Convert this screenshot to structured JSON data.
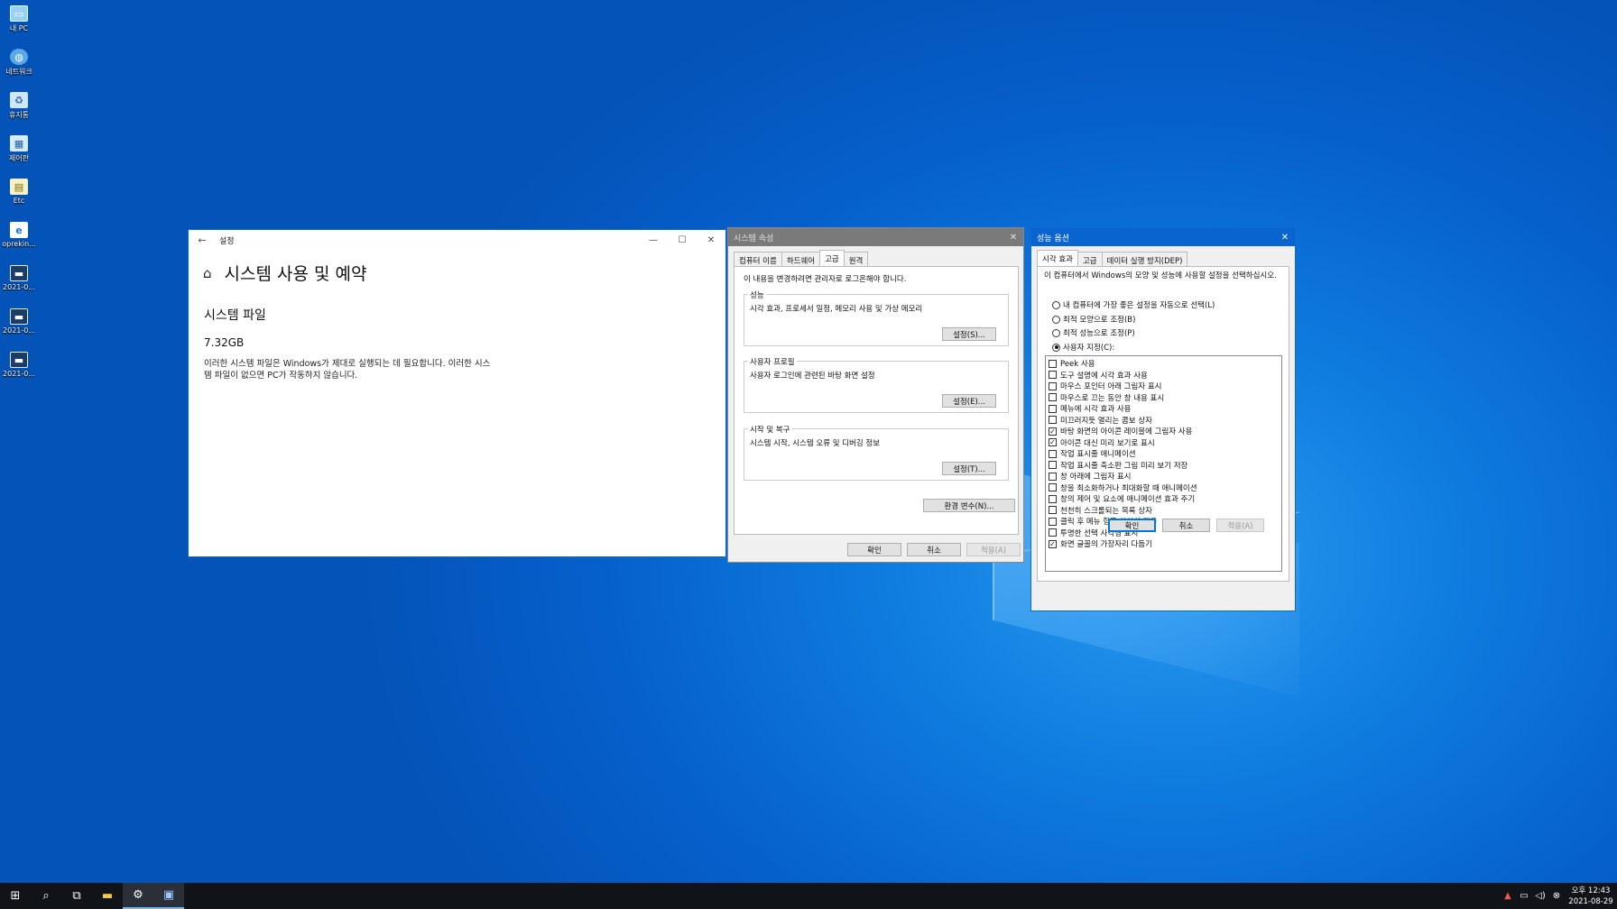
{
  "desktop": {
    "icons": [
      {
        "label": "내 PC",
        "icon": "computer-icon"
      },
      {
        "label": "네트워크",
        "icon": "network-icon"
      },
      {
        "label": "휴지통",
        "icon": "recycle-bin-icon"
      },
      {
        "label": "제어판",
        "icon": "control-panel-icon"
      },
      {
        "label": "Etc",
        "icon": "folder-icon"
      },
      {
        "label": "oprekin...",
        "icon": "internet-shortcut-icon"
      },
      {
        "label": "2021-0...",
        "icon": "screenshot-file-icon"
      },
      {
        "label": "2021-0...",
        "icon": "screenshot-file-icon"
      },
      {
        "label": "2021-0...",
        "icon": "screenshot-file-icon"
      }
    ]
  },
  "settings": {
    "title": "설정",
    "heading": "시스템 사용 및 예약",
    "subheading": "시스템 파일",
    "size": "7.32GB",
    "description": "이러한 시스템 파일은 Windows가 제대로 실행되는 데 필요합니다. 이러한 시스템 파일이 없으면 PC가 작동하지 않습니다."
  },
  "system_properties": {
    "title": "시스템 속성",
    "tabs": [
      "컴퓨터 이름",
      "하드웨어",
      "고급",
      "원격"
    ],
    "active_tab": "고급",
    "admin_note": "이 내용을 변경하려면 관리자로 로그온해야 합니다.",
    "performance": {
      "label": "성능",
      "text": "시각 효과, 프로세서 일정, 메모리 사용 및 가상 메모리",
      "button": "설정(S)..."
    },
    "user_profiles": {
      "label": "사용자 프로필",
      "text": "사용자 로그인에 관련된 바탕 화면 설정",
      "button": "설정(E)..."
    },
    "startup_recovery": {
      "label": "시작 및 복구",
      "text": "시스템 시작, 시스템 오류 및 디버깅 정보",
      "button": "설정(T)..."
    },
    "env_button": "환경 변수(N)...",
    "ok": "확인",
    "cancel": "취소",
    "apply": "적용(A)"
  },
  "performance_options": {
    "title": "성능 옵션",
    "tabs": [
      "시각 효과",
      "고급",
      "데이터 실행 방지(DEP)"
    ],
    "active_tab": "시각 효과",
    "intro": "이 컴퓨터에서 Windows의 모양 및 성능에 사용할 설정을 선택하십시오.",
    "radios": [
      {
        "label": "내 컴퓨터에 가장 좋은 설정을 자동으로 선택(L)",
        "selected": false
      },
      {
        "label": "최적 모양으로 조정(B)",
        "selected": false
      },
      {
        "label": "최적 성능으로 조정(P)",
        "selected": false
      },
      {
        "label": "사용자 지정(C):",
        "selected": true
      }
    ],
    "checks": [
      {
        "label": "Peek 사용",
        "checked": false
      },
      {
        "label": "도구 설명에 시각 효과 사용",
        "checked": false
      },
      {
        "label": "마우스 포인터 아래 그림자 표시",
        "checked": false
      },
      {
        "label": "마우스로 끄는 동안 창 내용 표시",
        "checked": false
      },
      {
        "label": "메뉴에 시각 효과 사용",
        "checked": false
      },
      {
        "label": "미끄러지듯 열리는 콤보 상자",
        "checked": false
      },
      {
        "label": "바탕 화면의 아이콘 레이블에 그림자 사용",
        "checked": true
      },
      {
        "label": "아이콘 대신 미리 보기로 표시",
        "checked": true
      },
      {
        "label": "작업 표시줄 애니메이션",
        "checked": false
      },
      {
        "label": "작업 표시줄 축소판 그림 미리 보기 저장",
        "checked": false
      },
      {
        "label": "창 아래에 그림자 표시",
        "checked": false
      },
      {
        "label": "창을 최소화하거나 최대화할 때 애니메이션",
        "checked": false
      },
      {
        "label": "창의 제어 및 요소에 애니메이션 효과 주기",
        "checked": false
      },
      {
        "label": "천천히 스크롤되는 목록 상자",
        "checked": false
      },
      {
        "label": "클릭 후 메뉴 항목 천천히 지움",
        "checked": false
      },
      {
        "label": "투명한 선택 사각형 표시",
        "checked": false
      },
      {
        "label": "화면 글꼴의 가장자리 다듬기",
        "checked": true
      }
    ],
    "ok": "확인",
    "cancel": "취소",
    "apply": "적용(A)"
  },
  "taskbar": {
    "buttons": [
      {
        "icon": "windows-start-icon"
      },
      {
        "icon": "search-icon"
      },
      {
        "icon": "task-view-icon"
      },
      {
        "icon": "file-explorer-icon"
      },
      {
        "icon": "settings-gear-icon"
      },
      {
        "icon": "system-properties-icon"
      }
    ],
    "tray_icons": [
      "warning-icon",
      "network-icon",
      "volume-icon",
      "notification-icon"
    ],
    "time": "오후 12:43",
    "date": "2021-08-29"
  }
}
